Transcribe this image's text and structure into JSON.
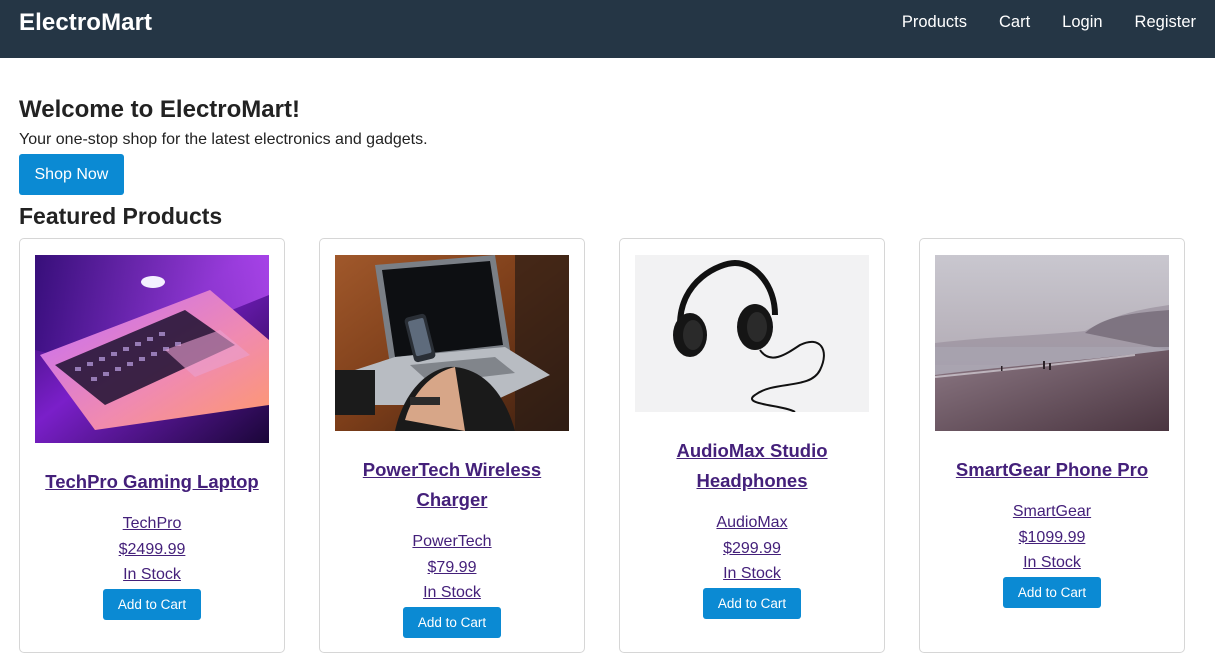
{
  "nav": {
    "brand": "ElectroMart",
    "links": [
      "Products",
      "Cart",
      "Login",
      "Register"
    ]
  },
  "hero": {
    "title": "Welcome to ElectroMart!",
    "subtitle": "Your one-stop shop for the latest electronics and gadgets.",
    "cta": "Shop Now"
  },
  "featured_title": "Featured Products",
  "products": [
    {
      "name": "TechPro Gaming Laptop",
      "brand": "TechPro",
      "price": "$2499.99",
      "stock": "In Stock",
      "button": "Add to Cart"
    },
    {
      "name": "PowerTech Wireless Charger",
      "brand": "PowerTech",
      "price": "$79.99",
      "stock": "In Stock",
      "button": "Add to Cart"
    },
    {
      "name": "AudioMax Studio Headphones",
      "brand": "AudioMax",
      "price": "$299.99",
      "stock": "In Stock",
      "button": "Add to Cart"
    },
    {
      "name": "SmartGear Phone Pro",
      "brand": "SmartGear",
      "price": "$1099.99",
      "stock": "In Stock",
      "button": "Add to Cart"
    }
  ],
  "colors": {
    "navbar": "#253645",
    "accent": "#0b8ad3",
    "link": "#44207a"
  }
}
